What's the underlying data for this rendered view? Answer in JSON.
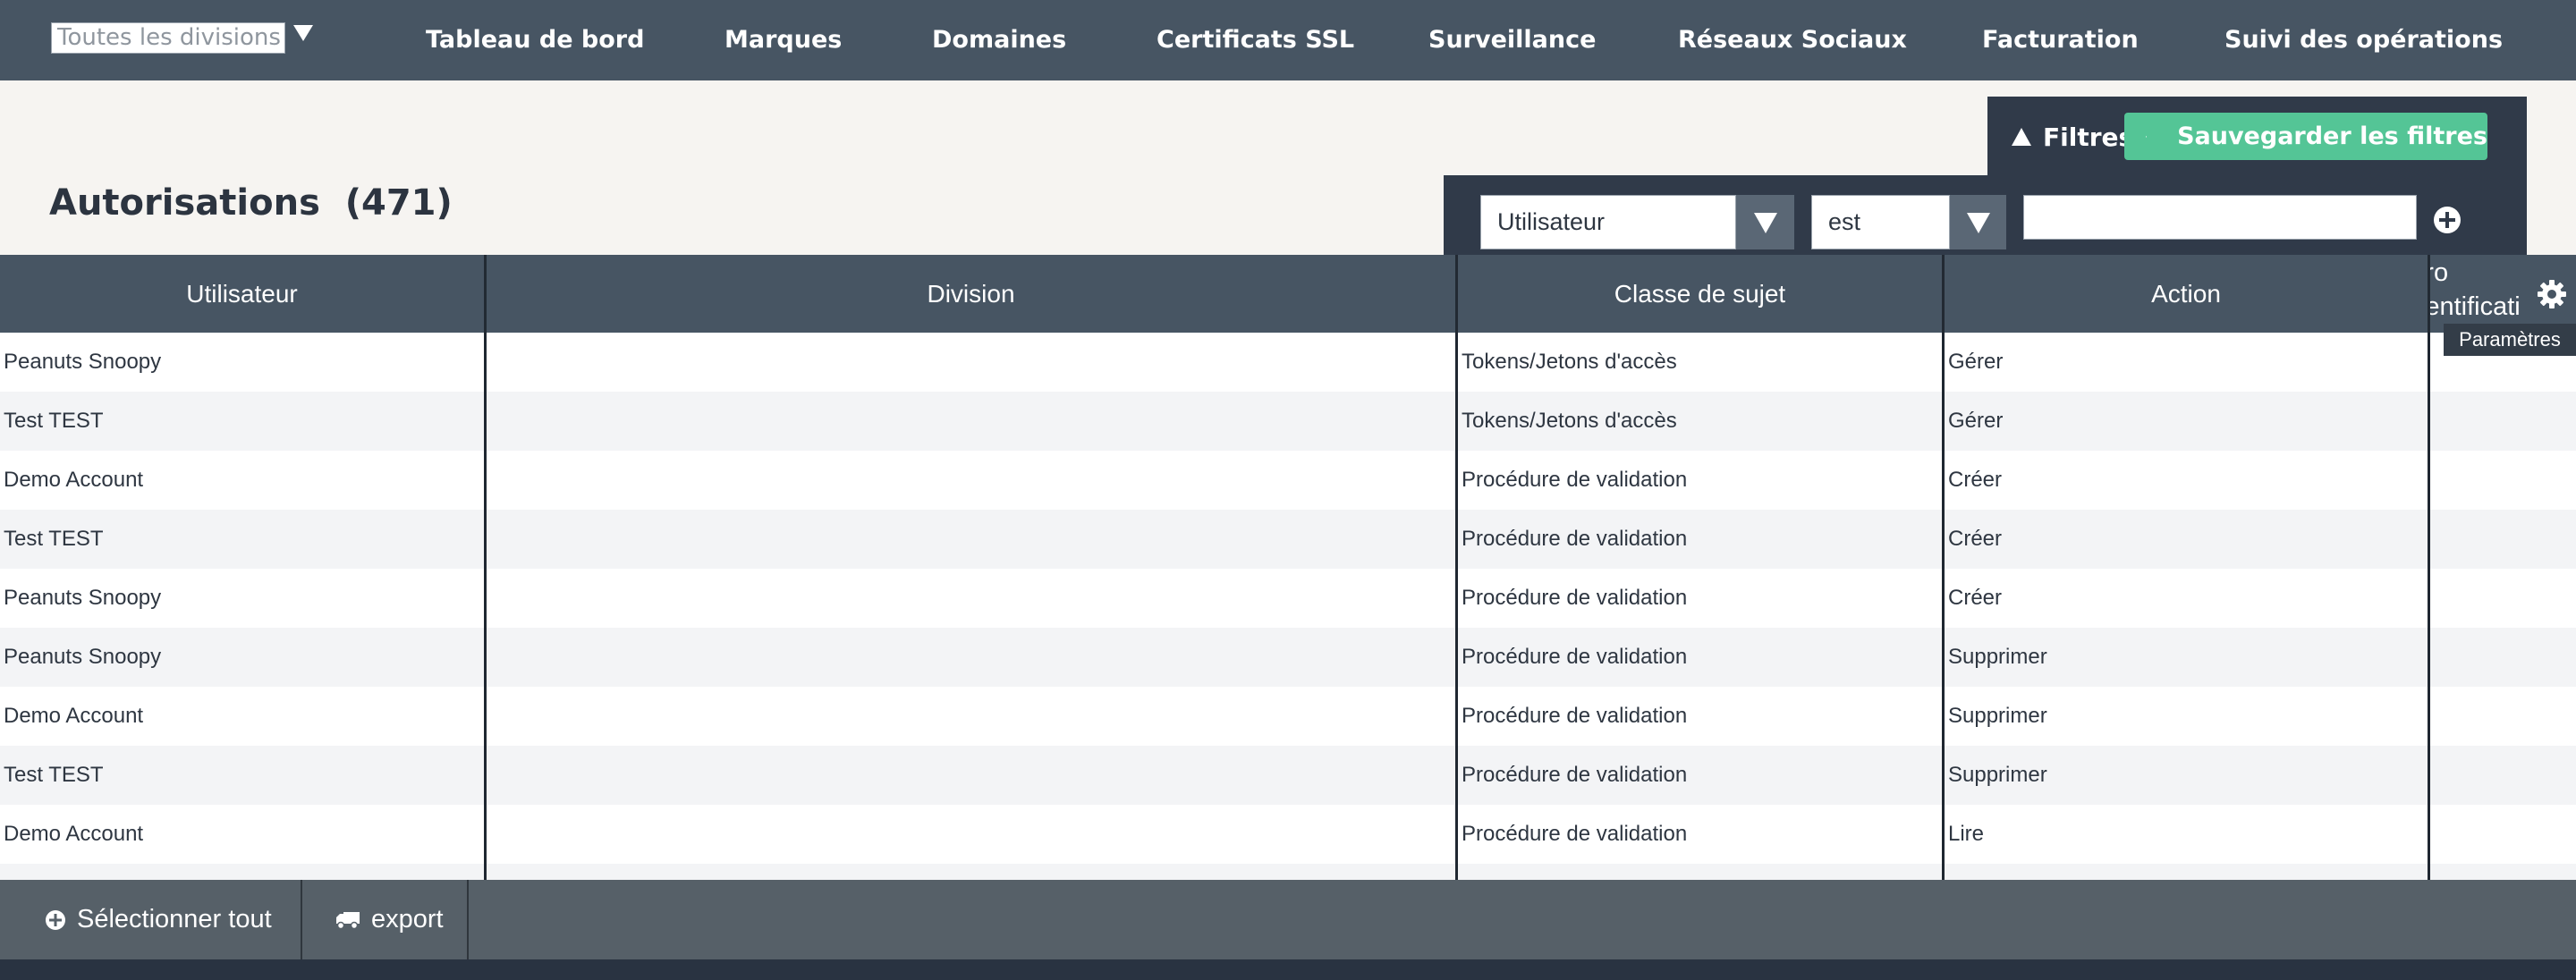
{
  "nav": {
    "division_select_value": "Toutes les divisions",
    "items": [
      "Tableau de bord",
      "Marques",
      "Domaines",
      "Certificats SSL",
      "Surveillance",
      "Réseaux Sociaux",
      "Facturation",
      "Suivi des opérations"
    ]
  },
  "filters": {
    "toggle_label": "Filtres",
    "save_label": "Sauvegarder les filtres",
    "field_value": "Utilisateur",
    "operator_value": "est",
    "value_input": ""
  },
  "page": {
    "title": "Autorisations",
    "count": "(471)"
  },
  "table": {
    "columns": [
      "Utilisateur",
      "Division",
      "Classe de sujet",
      "Action"
    ],
    "partial_column_lines": [
      "méro",
      "uthentificati"
    ],
    "settings_tooltip": "Paramètres",
    "rows": [
      {
        "user": "Peanuts Snoopy",
        "division": "",
        "subject": "Tokens/Jetons d'accès",
        "action": "Gérer"
      },
      {
        "user": "Test TEST",
        "division": "",
        "subject": "Tokens/Jetons d'accès",
        "action": "Gérer"
      },
      {
        "user": "Demo Account",
        "division": "",
        "subject": "Procédure de validation",
        "action": "Créer"
      },
      {
        "user": "Test TEST",
        "division": "",
        "subject": "Procédure de validation",
        "action": "Créer"
      },
      {
        "user": "Peanuts Snoopy",
        "division": "",
        "subject": "Procédure de validation",
        "action": "Créer"
      },
      {
        "user": "Peanuts Snoopy",
        "division": "",
        "subject": "Procédure de validation",
        "action": "Supprimer"
      },
      {
        "user": "Demo Account",
        "division": "",
        "subject": "Procédure de validation",
        "action": "Supprimer"
      },
      {
        "user": "Test TEST",
        "division": "",
        "subject": "Procédure de validation",
        "action": "Supprimer"
      },
      {
        "user": "Demo Account",
        "division": "",
        "subject": "Procédure de validation",
        "action": "Lire"
      }
    ]
  },
  "footer": {
    "select_all_label": "Sélectionner tout",
    "export_label": "export"
  },
  "colors": {
    "nav_bg": "#475563",
    "filter_panel_bg": "#303a49",
    "save_button_bg": "#54c596",
    "footer_bg": "#566068",
    "page_bg": "#f6f4f1"
  }
}
